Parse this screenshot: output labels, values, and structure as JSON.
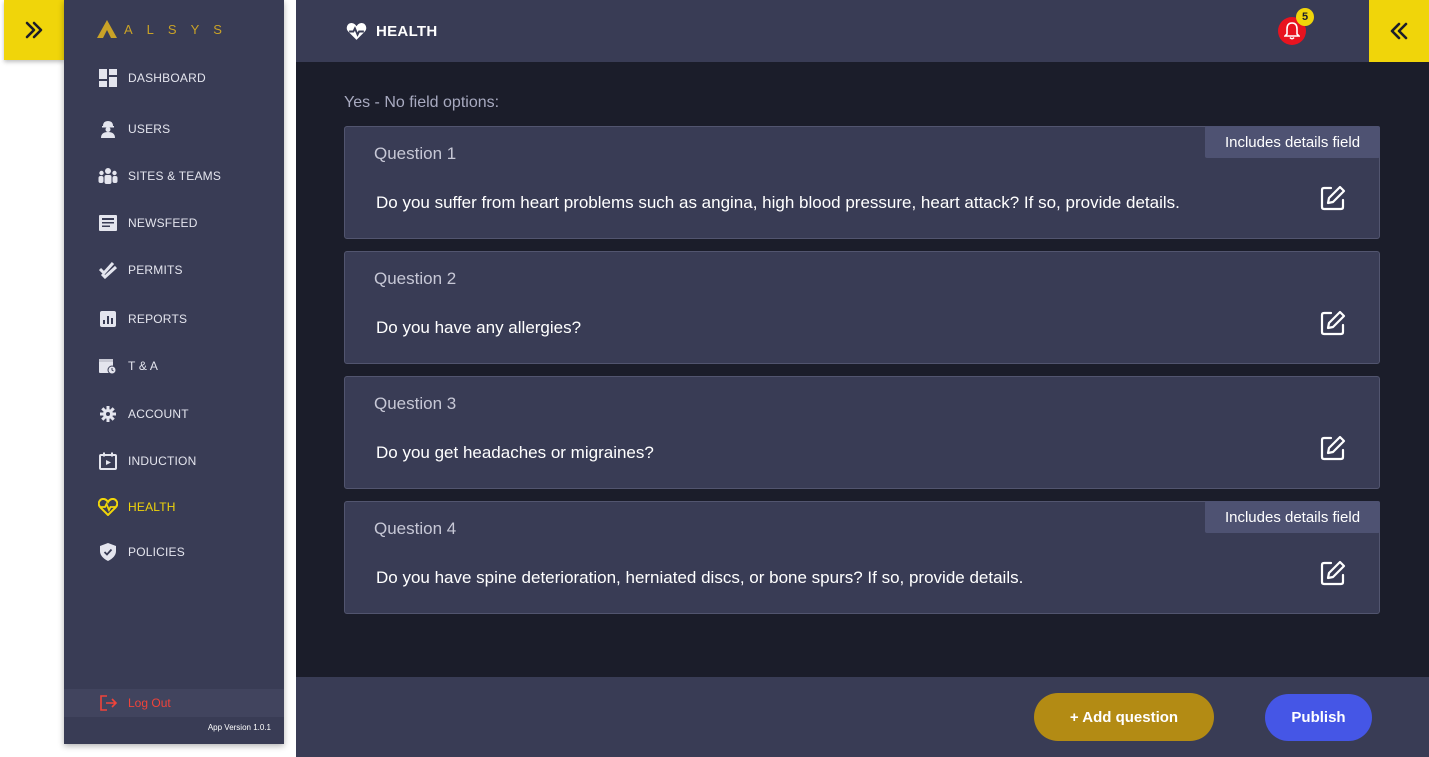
{
  "app": {
    "brand": "ALSYS",
    "version": "App Version 1.0.1",
    "accent": "#f0d50a"
  },
  "sidebar": {
    "items": [
      {
        "label": "DASHBOARD",
        "icon": "dashboard-icon"
      },
      {
        "label": "USERS",
        "icon": "worker-icon"
      },
      {
        "label": "SITES & TEAMS",
        "icon": "team-icon"
      },
      {
        "label": "NEWSFEED",
        "icon": "newspaper-icon"
      },
      {
        "label": "PERMITS",
        "icon": "check-icon"
      },
      {
        "label": "REPORTS",
        "icon": "report-icon"
      },
      {
        "label": "T & A",
        "icon": "timesheet-icon"
      },
      {
        "label": "ACCOUNT",
        "icon": "gear-icon"
      },
      {
        "label": "INDUCTION",
        "icon": "calendar-icon"
      },
      {
        "label": "HEALTH",
        "icon": "heartbeat-icon",
        "active": true
      },
      {
        "label": "POLICIES",
        "icon": "shield-icon"
      }
    ],
    "logout": "Log Out"
  },
  "header": {
    "title": "HEALTH",
    "notifications_count": "5"
  },
  "main": {
    "section_title": "Yes - No field options:",
    "details_tag": "Includes details field",
    "questions": [
      {
        "title": "Question 1",
        "text": "Do you suffer from heart problems such as angina, high blood pressure, heart attack? If so, provide details.",
        "has_details": true
      },
      {
        "title": "Question 2",
        "text": "Do you have any allergies?",
        "has_details": false
      },
      {
        "title": "Question 3",
        "text": "Do you get headaches or migraines?",
        "has_details": false
      },
      {
        "title": "Question 4",
        "text": "Do you have spine deterioration, herniated discs, or bone spurs? If so, provide details.",
        "has_details": true
      }
    ]
  },
  "footer": {
    "add_question": "+ Add question",
    "publish": "Publish"
  }
}
